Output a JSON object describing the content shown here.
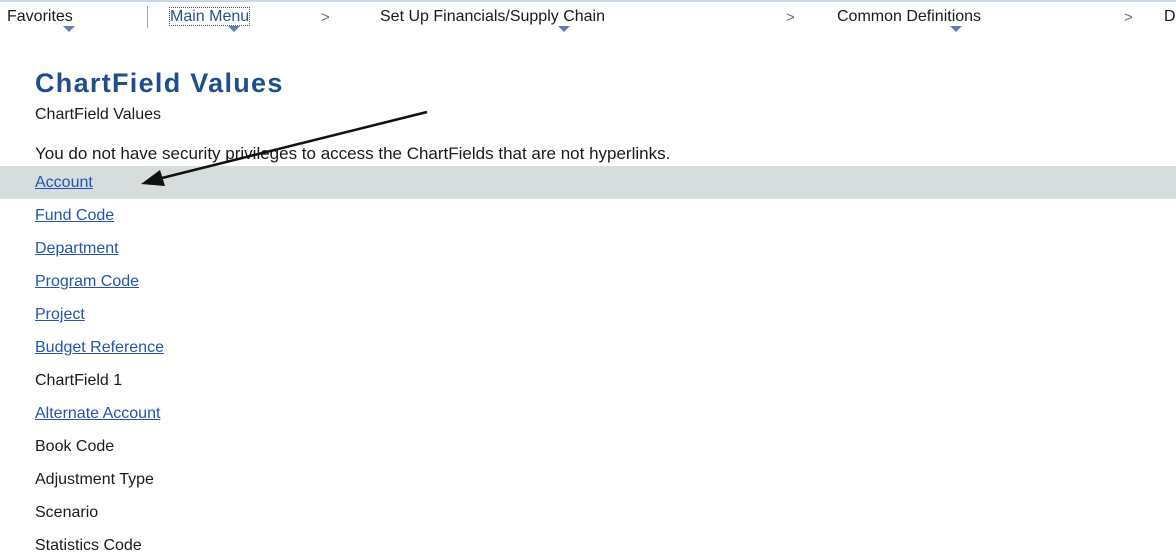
{
  "nav": {
    "items": [
      {
        "label": "Favorites"
      },
      {
        "label": "Main Menu"
      },
      {
        "label": "Set Up Financials/Supply Chain"
      },
      {
        "label": "Common Definitions"
      },
      {
        "label": "D"
      }
    ],
    "separator": ">"
  },
  "page": {
    "title": "ChartField Values",
    "subtitle": "ChartField Values",
    "notice": "You do not have security privileges to access the ChartFields that are not hyperlinks."
  },
  "chartfields": [
    {
      "label": "Account",
      "link": true
    },
    {
      "label": "Fund Code",
      "link": true
    },
    {
      "label": "Department",
      "link": true
    },
    {
      "label": "Program Code",
      "link": true
    },
    {
      "label": "Project",
      "link": true
    },
    {
      "label": "Budget Reference",
      "link": true
    },
    {
      "label": "ChartField 1",
      "link": false
    },
    {
      "label": "Alternate Account",
      "link": true
    },
    {
      "label": "Book Code",
      "link": false
    },
    {
      "label": "Adjustment Type",
      "link": false
    },
    {
      "label": "Scenario",
      "link": false
    },
    {
      "label": "Statistics Code",
      "link": false
    }
  ],
  "colors": {
    "title": "#1f4e8d",
    "link": "#2355b0",
    "highlight_row": "#d7dcdd",
    "caret": "#5b7fb8"
  }
}
